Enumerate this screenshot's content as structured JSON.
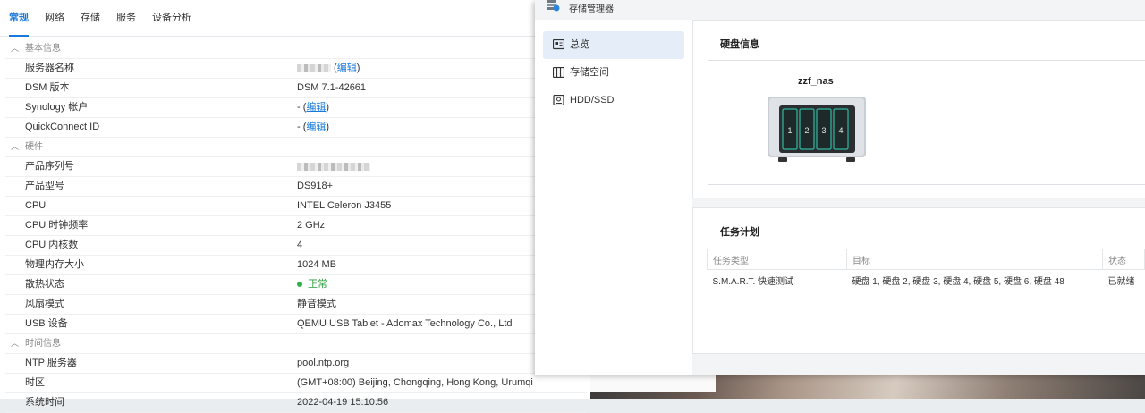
{
  "info_center": {
    "tabs": [
      {
        "label": "常规",
        "active": true
      },
      {
        "label": "网络",
        "active": false
      },
      {
        "label": "存储",
        "active": false
      },
      {
        "label": "服务",
        "active": false
      },
      {
        "label": "设备分析",
        "active": false
      }
    ],
    "sections": {
      "basic": "基本信息",
      "hardware": "硬件",
      "time": "时间信息"
    },
    "rows": {
      "server_name": {
        "label": "服务器名称",
        "edit": "编辑"
      },
      "dsm": {
        "label": "DSM 版本",
        "value": "DSM 7.1-42661"
      },
      "synology_account": {
        "label": "Synology 帐户",
        "prefix": "- (",
        "edit": "编辑",
        "suffix": ")"
      },
      "quickconnect": {
        "label": "QuickConnect ID",
        "prefix": "- (",
        "edit": "编辑",
        "suffix": ")"
      },
      "serial": {
        "label": "产品序列号"
      },
      "model": {
        "label": "产品型号",
        "value": "DS918+"
      },
      "cpu": {
        "label": "CPU",
        "value": "INTEL Celeron J3455"
      },
      "cpu_freq": {
        "label": "CPU 时钟频率",
        "value": "2 GHz"
      },
      "cpu_cores": {
        "label": "CPU 内核数",
        "value": "4"
      },
      "memory": {
        "label": "物理内存大小",
        "value": "1024 MB"
      },
      "thermal": {
        "label": "散热状态",
        "value": "正常"
      },
      "fan": {
        "label": "风扇模式",
        "value": "静音模式"
      },
      "usb": {
        "label": "USB 设备",
        "value": "QEMU USB Tablet - Adomax Technology Co., Ltd"
      },
      "ntp": {
        "label": "NTP 服务器",
        "value": "pool.ntp.org"
      },
      "timezone": {
        "label": "时区",
        "value": "(GMT+08:00) Beijing, Chongqing, Hong Kong, Urumqi"
      },
      "system_time": {
        "label": "系统时间",
        "value": "2022-04-19 15:10:56"
      }
    }
  },
  "storage_manager": {
    "title": "存储管理器",
    "nav": [
      {
        "label": "总览",
        "icon": "overview-icon",
        "active": true
      },
      {
        "label": "存储空间",
        "icon": "storage-pool-icon",
        "active": false
      },
      {
        "label": "HDD/SSD",
        "icon": "hdd-icon",
        "active": false
      }
    ],
    "disk_info": {
      "title": "硬盘信息",
      "nas_name": "zzf_nas",
      "bays": [
        "1",
        "2",
        "3",
        "4"
      ]
    },
    "tasks": {
      "title": "任务计划",
      "headers": [
        "任务类型",
        "目标",
        "状态"
      ],
      "rows": [
        {
          "type": "S.M.A.R.T. 快速测试",
          "target": "硬盘 1, 硬盘 2, 硬盘 3, 硬盘 4, 硬盘 5, 硬盘 6, 硬盘 48",
          "status": "已就绪"
        }
      ]
    }
  },
  "colors": {
    "accent": "#1a7ad9",
    "status_ok": "#2eb24a",
    "nas_bay": "#1e2a2a",
    "nas_bay_border": "#2fb6a0"
  }
}
